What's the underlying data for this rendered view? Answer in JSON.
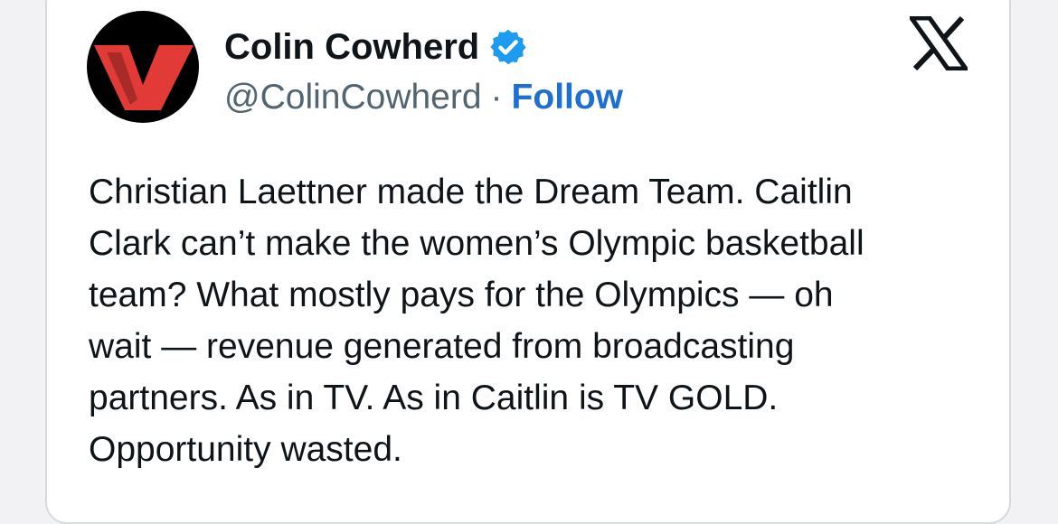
{
  "author": {
    "name": "Colin Cowherd",
    "handle": "@ColinCowherd",
    "separator": "·",
    "follow_label": "Follow",
    "verified": true,
    "avatar_icon": "red-v-logo-icon"
  },
  "platform_icon": "x-logo-icon",
  "tweet": {
    "lines": [
      "Christian Laettner made the Dream Team. Caitlin",
      "Clark can’t make the women’s Olympic basketball",
      "team? What mostly pays for the Olympics — oh",
      "wait — revenue generated from broadcasting",
      "partners. As in TV. As in Caitlin is TV GOLD.",
      "Opportunity wasted."
    ]
  },
  "colors": {
    "follow": "#1d6fd1",
    "verified": "#1d9bf0",
    "avatar_accent": "#e23a36",
    "text": "#0f1419",
    "secondary_text": "#536471"
  }
}
